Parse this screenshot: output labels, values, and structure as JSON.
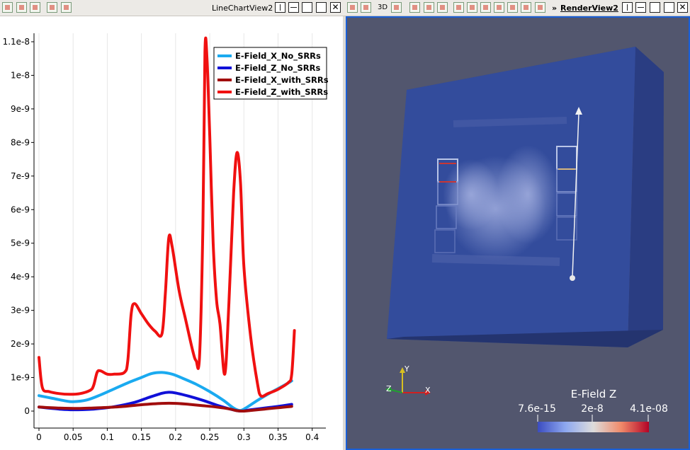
{
  "toolbar": {
    "chart_view_title": "LineChartView2",
    "render_view_title": "RenderView2",
    "render_view_prefix": "»",
    "mode_3d_label": "3D"
  },
  "chart_data": {
    "type": "line",
    "xlim": [
      0,
      0.42
    ],
    "ylim": [
      -3e-10,
      1.12e-08
    ],
    "xticks": [
      0,
      0.05,
      0.1,
      0.15,
      0.2,
      0.25,
      0.3,
      0.35,
      0.4
    ],
    "xtick_labels": [
      "0",
      "0.05",
      "0.1",
      "0.15",
      "0.2",
      "0.25",
      "0.3",
      "0.35",
      "0.4"
    ],
    "yticks": [
      0,
      1e-09,
      2e-09,
      3e-09,
      4e-09,
      5e-09,
      6e-09,
      7e-09,
      8e-09,
      9e-09,
      1e-08,
      1.1e-08
    ],
    "ytick_labels": [
      "0",
      "1e-9",
      "2e-9",
      "3e-9",
      "4e-9",
      "5e-9",
      "6e-9",
      "7e-9",
      "8e-9",
      "9e-9",
      "1e-8",
      "1.1e-8"
    ],
    "grid": "vertical",
    "legend_position": "top-right",
    "series": [
      {
        "name": "E-Field_X_No_SRRs",
        "color": "#1aaaf0",
        "points": [
          [
            0,
            4.6e-10
          ],
          [
            0.02,
            3.8e-10
          ],
          [
            0.04,
            3e-10
          ],
          [
            0.05,
            2.8e-10
          ],
          [
            0.07,
            3.3e-10
          ],
          [
            0.09,
            4.8e-10
          ],
          [
            0.11,
            6.6e-10
          ],
          [
            0.13,
            8.4e-10
          ],
          [
            0.15,
            1e-09
          ],
          [
            0.165,
            1.12e-09
          ],
          [
            0.18,
            1.15e-09
          ],
          [
            0.195,
            1.1e-09
          ],
          [
            0.21,
            9.8e-10
          ],
          [
            0.23,
            8e-10
          ],
          [
            0.25,
            5.8e-10
          ],
          [
            0.27,
            3.2e-10
          ],
          [
            0.285,
            9e-11
          ],
          [
            0.295,
            2e-11
          ],
          [
            0.305,
            1.2e-10
          ],
          [
            0.32,
            3.2e-10
          ],
          [
            0.34,
            5.6e-10
          ],
          [
            0.36,
            7.8e-10
          ],
          [
            0.37,
            9e-10
          ]
        ]
      },
      {
        "name": "E-Field_Z_No_SRRs",
        "color": "#1010d8",
        "points": [
          [
            0,
            1.2e-10
          ],
          [
            0.03,
            6e-11
          ],
          [
            0.05,
            4e-11
          ],
          [
            0.08,
            6e-11
          ],
          [
            0.11,
            1.3e-10
          ],
          [
            0.14,
            2.6e-10
          ],
          [
            0.16,
            4e-10
          ],
          [
            0.18,
            5.3e-10
          ],
          [
            0.19,
            5.6e-10
          ],
          [
            0.2,
            5.4e-10
          ],
          [
            0.22,
            4.4e-10
          ],
          [
            0.24,
            3.2e-10
          ],
          [
            0.26,
            1.8e-10
          ],
          [
            0.28,
            6e-11
          ],
          [
            0.295,
            0
          ],
          [
            0.31,
            4e-11
          ],
          [
            0.33,
            9e-11
          ],
          [
            0.35,
            1.4e-10
          ],
          [
            0.37,
            2e-10
          ]
        ]
      },
      {
        "name": "E-Field_X_with_SRRs",
        "color": "#a10d0d",
        "points": [
          [
            0,
            1.2e-10
          ],
          [
            0.03,
            9e-11
          ],
          [
            0.06,
            8e-11
          ],
          [
            0.09,
            1e-10
          ],
          [
            0.12,
            1.3e-10
          ],
          [
            0.15,
            1.9e-10
          ],
          [
            0.18,
            2.3e-10
          ],
          [
            0.2,
            2.3e-10
          ],
          [
            0.22,
            2e-10
          ],
          [
            0.24,
            1.6e-10
          ],
          [
            0.26,
            1.2e-10
          ],
          [
            0.28,
            6e-11
          ],
          [
            0.29,
            1e-11
          ],
          [
            0.3,
            0
          ],
          [
            0.31,
            2e-11
          ],
          [
            0.33,
            6e-11
          ],
          [
            0.35,
            1e-10
          ],
          [
            0.37,
            1.4e-10
          ]
        ]
      },
      {
        "name": "E-Field_Z_with_SRRs",
        "color": "#f01010",
        "points": [
          [
            0,
            1.6e-09
          ],
          [
            0.005,
            7e-10
          ],
          [
            0.015,
            5.8e-10
          ],
          [
            0.03,
            5.2e-10
          ],
          [
            0.045,
            5e-10
          ],
          [
            0.06,
            5.2e-10
          ],
          [
            0.075,
            6.2e-10
          ],
          [
            0.08,
            7.6e-10
          ],
          [
            0.085,
            1.15e-09
          ],
          [
            0.09,
            1.2e-09
          ],
          [
            0.1,
            1.1e-09
          ],
          [
            0.11,
            1.1e-09
          ],
          [
            0.125,
            1.15e-09
          ],
          [
            0.13,
            1.5e-09
          ],
          [
            0.135,
            2.9e-09
          ],
          [
            0.14,
            3.2e-09
          ],
          [
            0.15,
            2.9e-09
          ],
          [
            0.16,
            2.6e-09
          ],
          [
            0.17,
            2.38e-09
          ],
          [
            0.18,
            2.3e-09
          ],
          [
            0.185,
            3.5e-09
          ],
          [
            0.19,
            5.15e-09
          ],
          [
            0.195,
            4.9e-09
          ],
          [
            0.205,
            3.6e-09
          ],
          [
            0.215,
            2.7e-09
          ],
          [
            0.225,
            1.8e-09
          ],
          [
            0.23,
            1.5e-09
          ],
          [
            0.235,
            1.6e-09
          ],
          [
            0.24,
            5.5e-09
          ],
          [
            0.243,
            1.07e-08
          ],
          [
            0.246,
            1.05e-08
          ],
          [
            0.25,
            8.2e-09
          ],
          [
            0.255,
            5e-09
          ],
          [
            0.26,
            3.3e-09
          ],
          [
            0.265,
            2.6e-09
          ],
          [
            0.272,
            1.1e-09
          ],
          [
            0.278,
            3.2e-09
          ],
          [
            0.285,
            6.5e-09
          ],
          [
            0.29,
            7.7e-09
          ],
          [
            0.295,
            6.8e-09
          ],
          [
            0.3,
            4.3e-09
          ],
          [
            0.31,
            2.2e-09
          ],
          [
            0.32,
            8e-10
          ],
          [
            0.325,
            4.5e-10
          ],
          [
            0.335,
            5.2e-10
          ],
          [
            0.35,
            6.5e-10
          ],
          [
            0.365,
            8.5e-10
          ],
          [
            0.37,
            1.1e-09
          ],
          [
            0.374,
            2.4e-09
          ]
        ]
      }
    ]
  },
  "render_view": {
    "scalar_bar_title": "E-Field Z",
    "scalar_bar_labels": [
      "7.6e-15",
      "2e-8",
      "4.1e-08"
    ],
    "axes_labels": {
      "x": "X",
      "y": "Y",
      "z": "Z"
    },
    "colors": {
      "background": "#52566e",
      "box_front": "#334c9c",
      "box_side": "#2a3d82",
      "box_top": "#2e4690"
    }
  }
}
